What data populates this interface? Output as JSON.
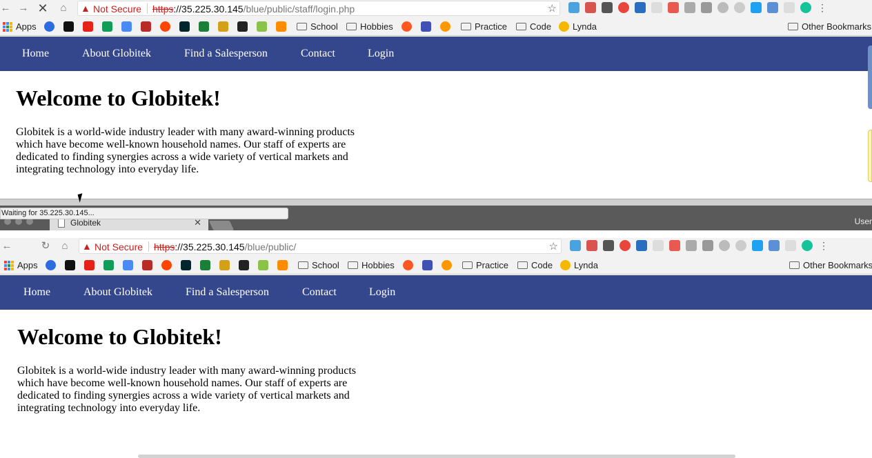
{
  "window1": {
    "address": {
      "security_label": "Not Secure",
      "url_scheme": "https",
      "url_host": "://35.225.30.145",
      "url_path": "/blue/public/staff/login.php"
    },
    "status_text": "Waiting for 35.225.30.145..."
  },
  "window2": {
    "tab_title": "Globitek",
    "user_label": "User",
    "address": {
      "security_label": "Not Secure",
      "url_scheme": "https",
      "url_host": "://35.225.30.145",
      "url_path": "/blue/public/"
    }
  },
  "bookmarks": {
    "apps": "Apps",
    "school": "School",
    "hobbies": "Hobbies",
    "practice": "Practice",
    "code": "Code",
    "lynda": "Lynda",
    "other": "Other Bookmarks"
  },
  "site": {
    "nav": [
      "Home",
      "About Globitek",
      "Find a Salesperson",
      "Contact",
      "Login"
    ],
    "heading": "Welcome to Globitek!",
    "body": "Globitek is a world-wide industry leader with many award-winning products which have become well-known household names. Our staff of experts are dedicated to finding synergies across a wide variety of vertical markets and integrating technology into everyday life."
  },
  "colors": {
    "nav_bg": "#35478c",
    "warning_red": "#c5221f"
  }
}
